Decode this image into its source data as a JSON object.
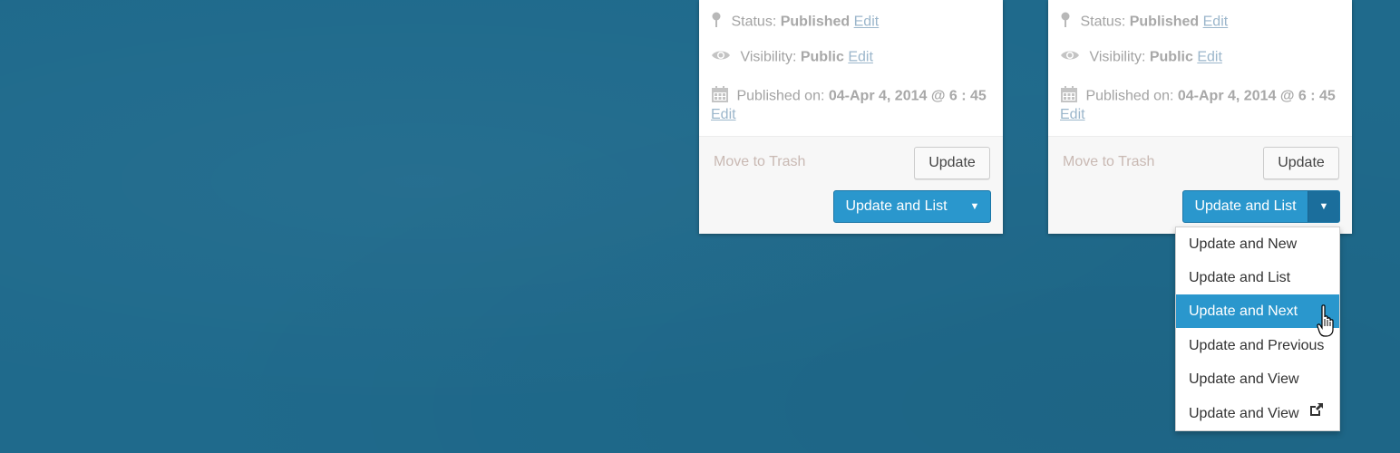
{
  "colors": {
    "background": "#1f6a8c",
    "primary_button": "#2a97cd",
    "link": "#9bb6cb",
    "muted_text": "#a3a3a3"
  },
  "panels": [
    {
      "status_label": "Status:",
      "status_value": "Published",
      "status_edit": "Edit",
      "visibility_label": "Visibility:",
      "visibility_value": "Public",
      "visibility_edit": "Edit",
      "published_label": "Published on:",
      "published_value": "04-Apr 4, 2014 @ 6 : 45",
      "published_edit": "Edit",
      "trash_label": "Move to Trash",
      "update_label": "Update",
      "split_label": "Update and List",
      "toggle_symbol": "▼",
      "dropdown_open": false
    },
    {
      "status_label": "Status:",
      "status_value": "Published",
      "status_edit": "Edit",
      "visibility_label": "Visibility:",
      "visibility_value": "Public",
      "visibility_edit": "Edit",
      "published_label": "Published on:",
      "published_value": "04-Apr 4, 2014 @ 6 : 45",
      "published_edit": "Edit",
      "trash_label": "Move to Trash",
      "update_label": "Update",
      "split_label": "Update and List",
      "toggle_symbol": "▼",
      "dropdown_open": true
    }
  ],
  "dropdown": {
    "items": [
      {
        "label": "Update and New",
        "active": false
      },
      {
        "label": "Update and List",
        "active": false
      },
      {
        "label": "Update and Next",
        "active": true
      },
      {
        "label": "Update and Previous",
        "active": false
      },
      {
        "label": "Update and View",
        "active": false
      },
      {
        "label": "Update and View",
        "active": false,
        "icon": "external-link-icon"
      }
    ]
  },
  "icons": {
    "status": "pin-icon",
    "visibility": "eye-icon",
    "published": "calendar-icon",
    "cursor": "hand-pointer-icon"
  }
}
